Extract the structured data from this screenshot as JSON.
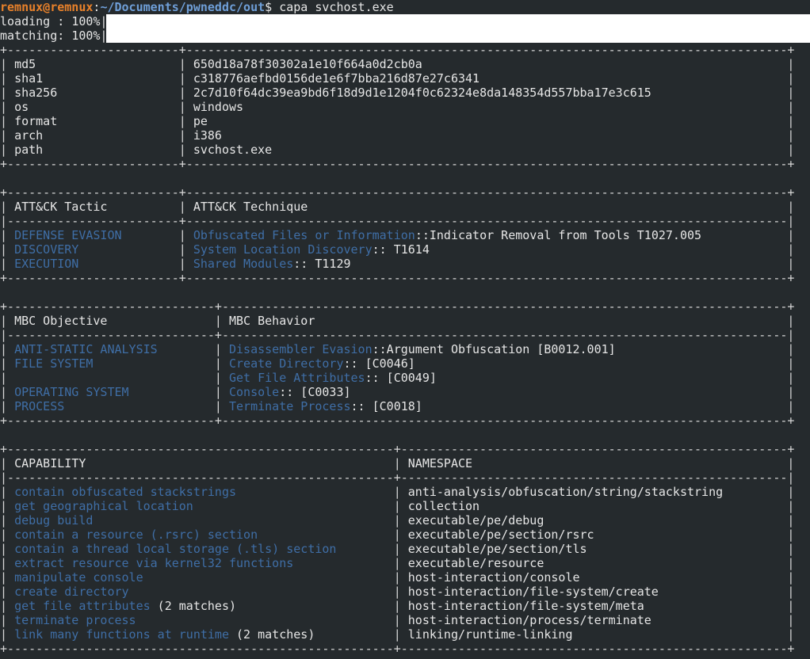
{
  "prompt": {
    "user_host": "remnux@remnux",
    "cwd": "~/Documents/pwneddc/out",
    "symbol": "$",
    "command": "capa svchost.exe"
  },
  "progress": [
    {
      "label": "loading : ",
      "percent": 100,
      "text": "100%|"
    },
    {
      "label": "matching: ",
      "percent": 100,
      "text": "100%|"
    }
  ],
  "meta_table": {
    "rows": [
      {
        "key": "md5",
        "value": "650d18a78f30302a1e10f664a0d2cb0a"
      },
      {
        "key": "sha1",
        "value": "c318776aefbd0156de1e6f7bba216d87e27c6341"
      },
      {
        "key": "sha256",
        "value": "2c7d10f64dc39ea9bd6f18d9d1e1204f0c62324e8da148354d557bba17e3c615"
      },
      {
        "key": "os",
        "value": "windows"
      },
      {
        "key": "format",
        "value": "pe"
      },
      {
        "key": "arch",
        "value": "i386"
      },
      {
        "key": "path",
        "value": "svchost.exe"
      }
    ]
  },
  "attack_table": {
    "headers": [
      "ATT&CK Tactic",
      "ATT&CK Technique"
    ],
    "rows": [
      {
        "tactic": "DEFENSE EVASION",
        "technique": "Obfuscated Files or Information",
        "detail": "::Indicator Removal from Tools T1027.005"
      },
      {
        "tactic": "DISCOVERY",
        "technique": "System Location Discovery",
        "detail": ":: T1614"
      },
      {
        "tactic": "EXECUTION",
        "technique": "Shared Modules",
        "detail": ":: T1129"
      }
    ]
  },
  "mbc_table": {
    "headers": [
      "MBC Objective",
      "MBC Behavior"
    ],
    "rows": [
      {
        "objective": "ANTI-STATIC ANALYSIS",
        "behavior": "Disassembler Evasion",
        "detail": "::Argument Obfuscation [B0012.001]"
      },
      {
        "objective": "FILE SYSTEM",
        "behavior": "Create Directory",
        "detail": ":: [C0046]"
      },
      {
        "objective": "",
        "behavior": "Get File Attributes",
        "detail": ":: [C0049]"
      },
      {
        "objective": "OPERATING SYSTEM",
        "behavior": "Console",
        "detail": ":: [C0033]"
      },
      {
        "objective": "PROCESS",
        "behavior": "Terminate Process",
        "detail": ":: [C0018]"
      }
    ]
  },
  "capability_table": {
    "headers": [
      "CAPABILITY",
      "NAMESPACE"
    ],
    "rows": [
      {
        "capability": "contain obfuscated stackstrings",
        "matches": "",
        "namespace": "anti-analysis/obfuscation/string/stackstring"
      },
      {
        "capability": "get geographical location",
        "matches": "",
        "namespace": "collection"
      },
      {
        "capability": "debug build",
        "matches": "",
        "namespace": "executable/pe/debug"
      },
      {
        "capability": "contain a resource (.rsrc) section",
        "matches": "",
        "namespace": "executable/pe/section/rsrc"
      },
      {
        "capability": "contain a thread local storage (.tls) section",
        "matches": "",
        "namespace": "executable/pe/section/tls"
      },
      {
        "capability": "extract resource via kernel32 functions",
        "matches": "",
        "namespace": "executable/resource"
      },
      {
        "capability": "manipulate console",
        "matches": "",
        "namespace": "host-interaction/console"
      },
      {
        "capability": "create directory",
        "matches": "",
        "namespace": "host-interaction/file-system/create"
      },
      {
        "capability": "get file attributes",
        "matches": " (2 matches)",
        "namespace": "host-interaction/file-system/meta"
      },
      {
        "capability": "terminate process",
        "matches": "",
        "namespace": "host-interaction/process/terminate"
      },
      {
        "capability": "link many functions at runtime",
        "matches": " (2 matches)",
        "namespace": "linking/runtime-linking"
      }
    ]
  }
}
